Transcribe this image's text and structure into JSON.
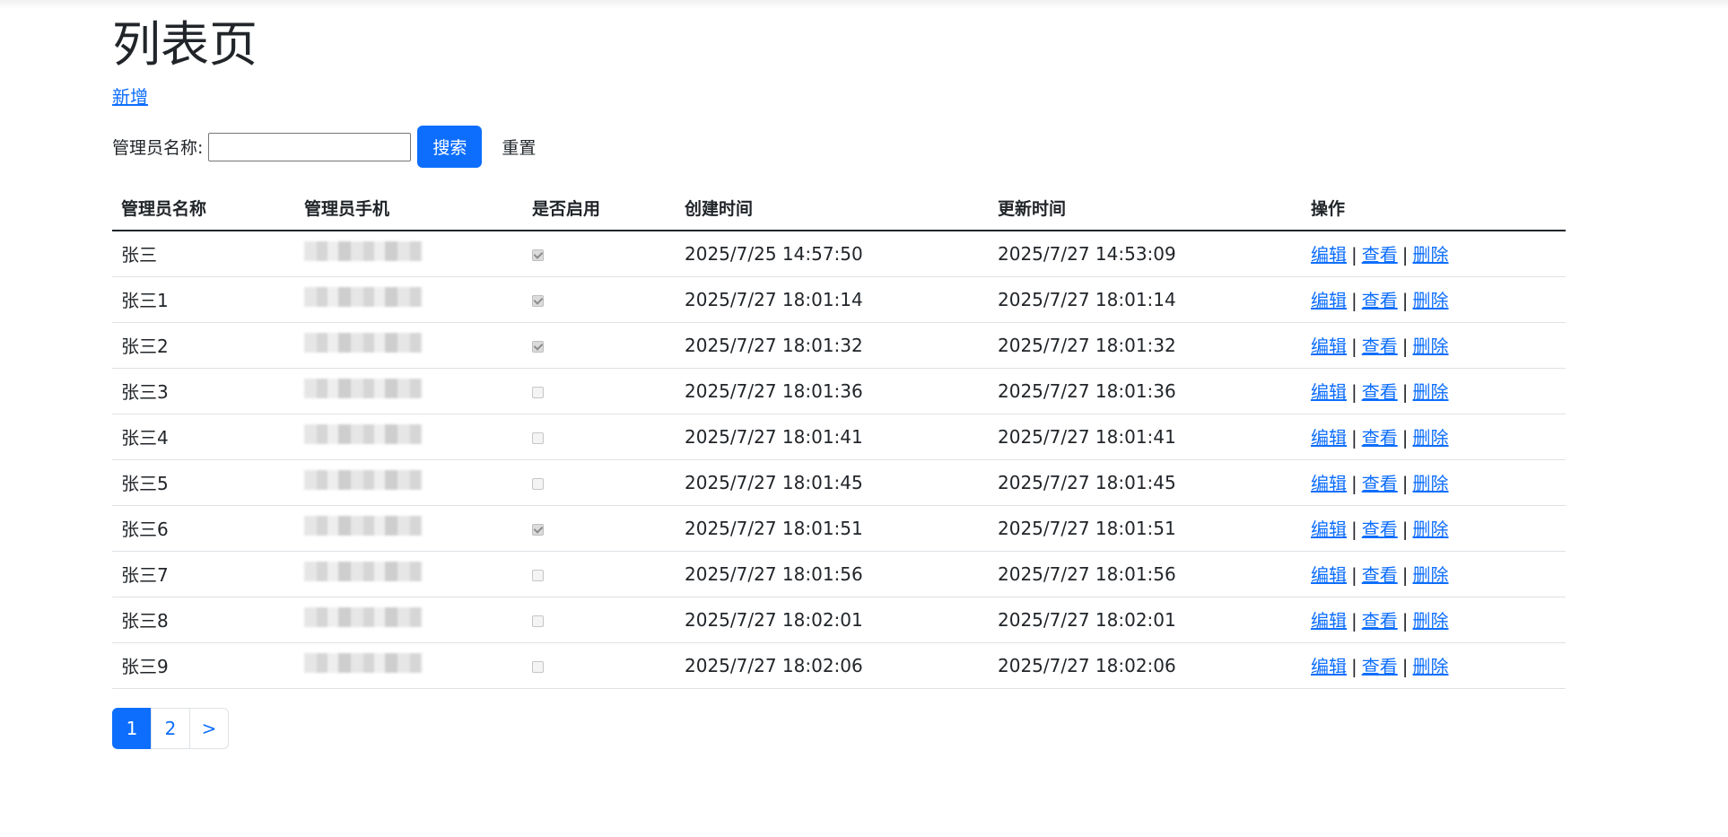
{
  "page": {
    "title": "列表页",
    "add_label": "新增"
  },
  "search": {
    "label": "管理员名称:",
    "value": "",
    "placeholder": "",
    "search_label": "搜索",
    "reset_label": "重置"
  },
  "table": {
    "headers": {
      "name": "管理员名称",
      "phone": "管理员手机",
      "enabled": "是否启用",
      "created": "创建时间",
      "updated": "更新时间",
      "actions": "操作"
    },
    "actions": {
      "edit": "编辑",
      "view": "查看",
      "delete": "删除",
      "separator": "|"
    },
    "rows": [
      {
        "name": "张三",
        "enabled": true,
        "created": "2025/7/25 14:57:50",
        "updated": "2025/7/27 14:53:09"
      },
      {
        "name": "张三1",
        "enabled": true,
        "created": "2025/7/27 18:01:14",
        "updated": "2025/7/27 18:01:14"
      },
      {
        "name": "张三2",
        "enabled": true,
        "created": "2025/7/27 18:01:32",
        "updated": "2025/7/27 18:01:32"
      },
      {
        "name": "张三3",
        "enabled": false,
        "created": "2025/7/27 18:01:36",
        "updated": "2025/7/27 18:01:36"
      },
      {
        "name": "张三4",
        "enabled": false,
        "created": "2025/7/27 18:01:41",
        "updated": "2025/7/27 18:01:41"
      },
      {
        "name": "张三5",
        "enabled": false,
        "created": "2025/7/27 18:01:45",
        "updated": "2025/7/27 18:01:45"
      },
      {
        "name": "张三6",
        "enabled": true,
        "created": "2025/7/27 18:01:51",
        "updated": "2025/7/27 18:01:51"
      },
      {
        "name": "张三7",
        "enabled": false,
        "created": "2025/7/27 18:01:56",
        "updated": "2025/7/27 18:01:56"
      },
      {
        "name": "张三8",
        "enabled": false,
        "created": "2025/7/27 18:02:01",
        "updated": "2025/7/27 18:02:01"
      },
      {
        "name": "张三9",
        "enabled": false,
        "created": "2025/7/27 18:02:06",
        "updated": "2025/7/27 18:02:06"
      }
    ]
  },
  "pagination": {
    "pages": [
      "1",
      "2"
    ],
    "current": "1",
    "next_label": ">"
  },
  "colors": {
    "primary": "#0d6efd",
    "text": "#212529",
    "border": "#dee2e6"
  }
}
